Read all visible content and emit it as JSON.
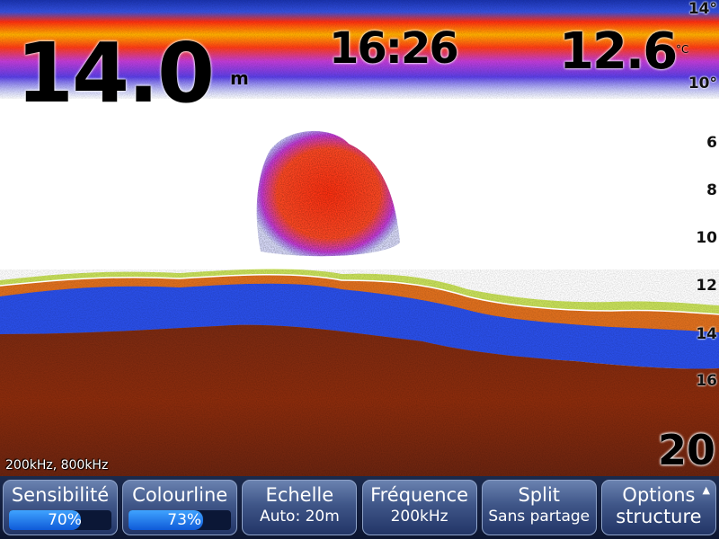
{
  "readouts": {
    "depth": "14.0",
    "depth_unit": "m",
    "time": "16:26",
    "temperature": "12.6",
    "temperature_unit": "°C"
  },
  "depth_scale": {
    "labels": [
      "14°",
      "10°",
      "6",
      "8",
      "10",
      "12",
      "14",
      "16"
    ],
    "max_range": "20"
  },
  "frequency_info": "200kHz, 800kHz",
  "menu": {
    "sensitivity": {
      "label": "Sensibilité",
      "value": "70%",
      "level": 0.7
    },
    "colourline": {
      "label": "Colourline",
      "value": "73%",
      "level": 0.73
    },
    "range": {
      "label": "Echelle",
      "value": "Auto: 20m"
    },
    "frequency": {
      "label": "Fréquence",
      "value": "200kHz"
    },
    "split": {
      "label": "Split",
      "value": "Sans partage"
    },
    "options": {
      "label": "Options",
      "value": "structure"
    }
  },
  "colors": {
    "sonar_background": "#ffffff",
    "menu_background": "#13214a",
    "slider_fill": "#1f7df0",
    "bottom_echo": "#8a2a0c",
    "strong_echo": "#ff3b1a"
  },
  "icons": {
    "options_caret": "caret-up-icon"
  }
}
